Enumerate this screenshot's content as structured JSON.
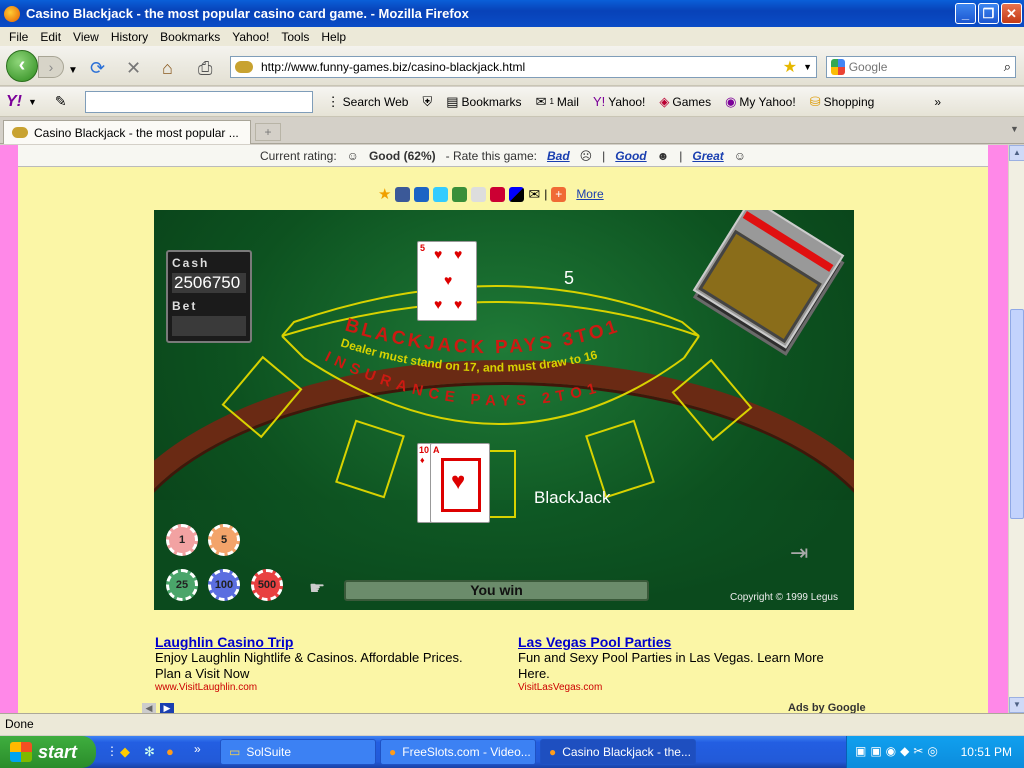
{
  "window": {
    "title": "Casino Blackjack - the most popular casino card game. - Mozilla Firefox"
  },
  "menu": [
    "File",
    "Edit",
    "View",
    "History",
    "Bookmarks",
    "Yahoo!",
    "Tools",
    "Help"
  ],
  "nav": {
    "url": "http://www.funny-games.biz/casino-blackjack.html",
    "search_placeholder": "Google"
  },
  "yahoo_toolbar": {
    "logo": "Y!",
    "search_web": "Search Web",
    "bookmarks": "Bookmarks",
    "mail": "Mail",
    "yahoo": "Yahoo!",
    "games": "Games",
    "my_yahoo": "My Yahoo!",
    "shopping": "Shopping",
    "mail_badge": "1"
  },
  "tab": {
    "label": "Casino Blackjack - the most popular ..."
  },
  "rating": {
    "current": "Current rating:",
    "value": "Good (62%)",
    "rate": "-   Rate this game:",
    "bad": "Bad",
    "good": "Good",
    "great": "Great"
  },
  "share": {
    "more": "More"
  },
  "game": {
    "cash_label": "Cash",
    "cash_value": "2506750",
    "bet_label": "Bet",
    "dealer_score": "5",
    "table_text1": "BLACKJACK PAYS 3TO1",
    "table_text2": "Dealer must stand on 17, and must draw to 16",
    "table_text3": "INSURANCE PAYS 2TO1",
    "result_label": "BlackJack",
    "status": "You win",
    "copyright": "Copyright © 1999 Legus",
    "chips": [
      "1",
      "5",
      "25",
      "100",
      "500"
    ],
    "dealer_card": {
      "rank": "5",
      "suit": "♥"
    },
    "player_cards": [
      {
        "rank": "10",
        "suit": "♦"
      },
      {
        "rank": "A",
        "suit": "♥"
      }
    ]
  },
  "ads": [
    {
      "title": "Laughlin Casino Trip",
      "text": "Enjoy Laughlin Nightlife & Casinos. Affordable Prices. Plan a Visit Now",
      "url": "www.VisitLaughlin.com"
    },
    {
      "title": "Las Vegas Pool Parties",
      "text": "Fun and Sexy Pool Parties in Las Vegas. Learn More Here.",
      "url": "VisitLasVegas.com"
    }
  ],
  "ads_by": "Ads by Google",
  "status_bar": "Done",
  "taskbar": {
    "start": "start",
    "tasks": [
      "SolSuite",
      "FreeSlots.com - Video...",
      "Casino Blackjack - the..."
    ],
    "clock": "10:51 PM"
  },
  "colors": {
    "felt": "#0d5220",
    "page_bg": "#fbf6a6",
    "side_bg": "#ff88e8",
    "line_yellow": "#d8d200",
    "text_red": "#cc1a12"
  }
}
